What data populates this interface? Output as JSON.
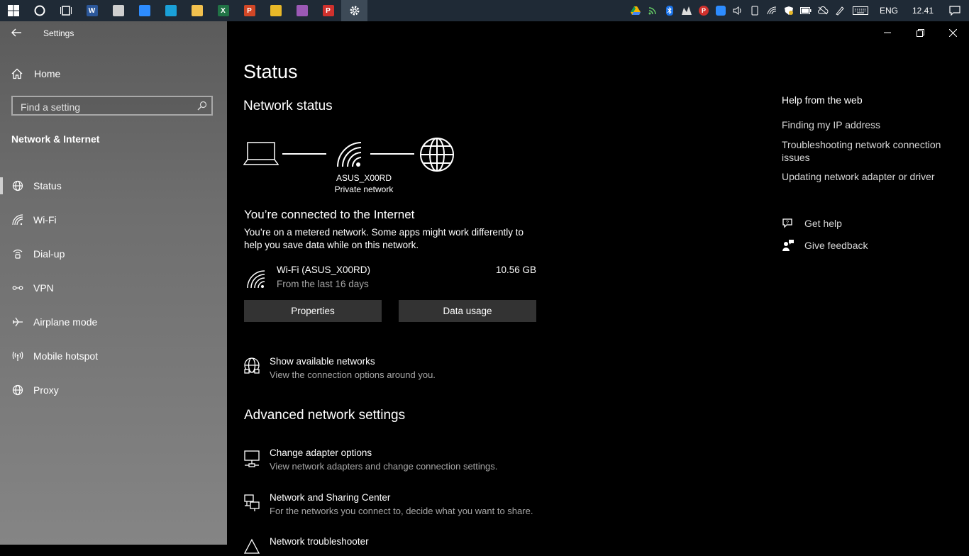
{
  "taskbar": {
    "apps": [
      {
        "name": "word",
        "letter": "W",
        "color": "#2b579a"
      },
      {
        "name": "clock",
        "letter": "",
        "color": "#cfcfcf"
      },
      {
        "name": "zoom",
        "letter": "",
        "color": "#2d8cff"
      },
      {
        "name": "edge",
        "letter": "",
        "color": "#1aa0d8"
      },
      {
        "name": "file-explorer",
        "letter": "",
        "color": "#f2c14e"
      },
      {
        "name": "excel",
        "letter": "X",
        "color": "#217346"
      },
      {
        "name": "powerpoint",
        "letter": "P",
        "color": "#d24726"
      },
      {
        "name": "chrome",
        "letter": "",
        "color": "#e8b828"
      },
      {
        "name": "winrar",
        "letter": "",
        "color": "#9b59b6"
      },
      {
        "name": "pdf",
        "letter": "P",
        "color": "#d0312d"
      }
    ],
    "tray": {
      "language": "ENG",
      "time": "12.41"
    }
  },
  "sidebar": {
    "window_title": "Settings",
    "home_label": "Home",
    "search_placeholder": "Find a setting",
    "section_title": "Network & Internet",
    "items": [
      {
        "label": "Status",
        "icon": "globe-icon"
      },
      {
        "label": "Wi-Fi",
        "icon": "wifi-icon"
      },
      {
        "label": "Dial-up",
        "icon": "dialup-icon"
      },
      {
        "label": "VPN",
        "icon": "vpn-icon"
      },
      {
        "label": "Airplane mode",
        "icon": "airplane-icon"
      },
      {
        "label": "Mobile hotspot",
        "icon": "hotspot-icon"
      },
      {
        "label": "Proxy",
        "icon": "globe-icon"
      }
    ],
    "selected_index": 0
  },
  "main": {
    "title": "Status",
    "network_status_heading": "Network status",
    "network_name": "ASUS_X00RD",
    "network_type": "Private network",
    "connected_title": "You’re connected to the Internet",
    "connected_desc": "You’re on a metered network. Some apps might work differently to help you save data while on this network.",
    "connection": {
      "name": "Wi-Fi (ASUS_X00RD)",
      "period": "From the last 16 days",
      "usage": "10.56 GB"
    },
    "properties_label": "Properties",
    "data_usage_label": "Data usage",
    "show_networks": {
      "title": "Show available networks",
      "subtitle": "View the connection options around you."
    },
    "advanced_heading": "Advanced network settings",
    "advanced_items": [
      {
        "title": "Change adapter options",
        "subtitle": "View network adapters and change connection settings."
      },
      {
        "title": "Network and Sharing Center",
        "subtitle": "For the networks you connect to, decide what you want to share."
      },
      {
        "title": "Network troubleshooter",
        "subtitle": ""
      }
    ]
  },
  "help": {
    "title": "Help from the web",
    "links": [
      "Finding my IP address",
      "Troubleshooting network connection issues",
      "Updating network adapter or driver"
    ],
    "get_help": "Get help",
    "give_feedback": "Give feedback"
  }
}
